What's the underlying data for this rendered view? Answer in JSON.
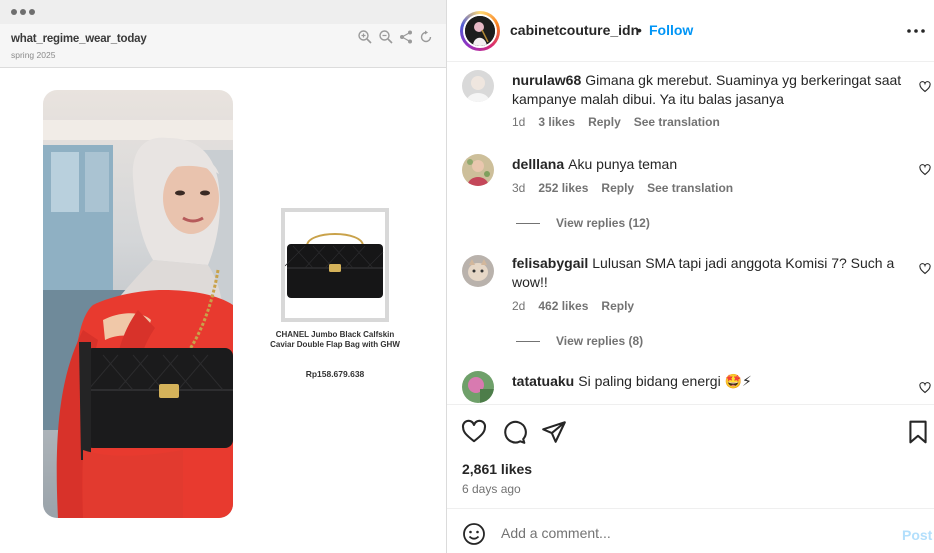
{
  "media": {
    "site_name": "what_regime_wear_today",
    "season": "spring 2025",
    "product": {
      "name": "CHANEL Jumbo Black Calfskin Caviar Double Flap Bag with GHW",
      "price": "Rp158.679.638"
    }
  },
  "header": {
    "username": "cabinetcouture_idn",
    "separator": "•",
    "follow_label": "Follow"
  },
  "comments": [
    {
      "user": "nurulaw68",
      "text": "Gimana gk merebut. Suaminya yg berkeringat saat kampanye malah dibui. Ya itu balas jasanya",
      "age": "1d",
      "likes": "3 likes",
      "reply": "Reply",
      "translate": "See translation"
    },
    {
      "user": "delllana",
      "text": "Aku punya teman",
      "age": "3d",
      "likes": "252 likes",
      "reply": "Reply",
      "translate": "See translation",
      "view_replies": "View replies (12)"
    },
    {
      "user": "felisabygail",
      "text": "Lulusan SMA tapi jadi anggota Komisi 7? Such a wow!!",
      "age": "2d",
      "likes": "462 likes",
      "reply": "Reply",
      "view_replies": "View replies (8)"
    },
    {
      "user": "tatatuaku",
      "text": "Si paling bidang energi 🤩⚡"
    }
  ],
  "post": {
    "likes": "2,861 likes",
    "date": "6 days ago"
  },
  "composer": {
    "placeholder": "Add a comment...",
    "post_label": "Post"
  },
  "colors": {
    "accent": "#0095f6",
    "post_disabled": "#b3dffc",
    "dress": "#e83a2f"
  },
  "icons": [
    "zoom-in-icon",
    "zoom-out-icon",
    "share-icon",
    "refresh-icon",
    "more-icon",
    "heart-icon",
    "comment-icon",
    "send-icon",
    "bookmark-icon",
    "emoji-icon"
  ]
}
